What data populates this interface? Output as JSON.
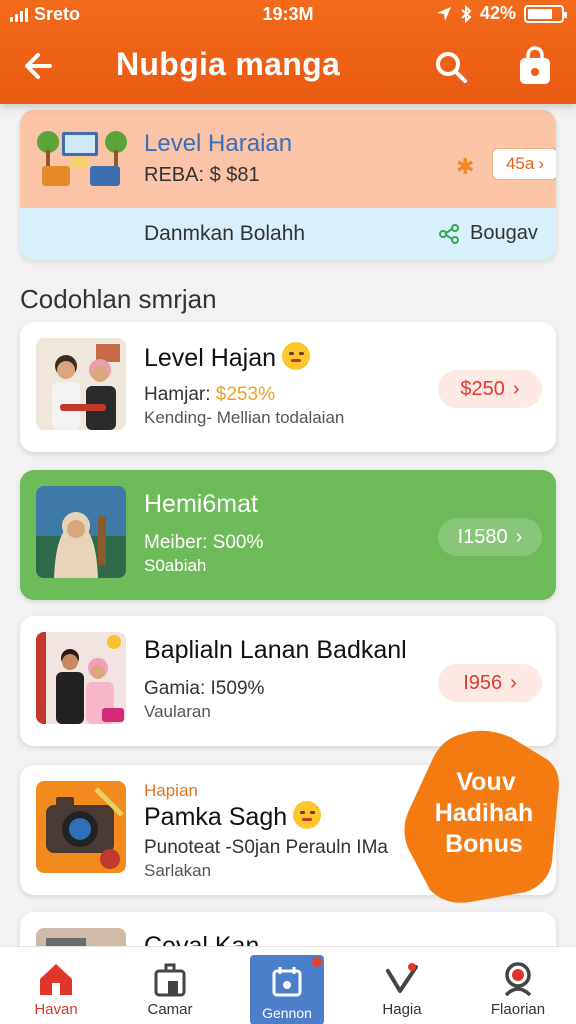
{
  "status_bar": {
    "carrier": "Sreto",
    "time": "19:3M",
    "battery": "42%"
  },
  "header": {
    "title": "Nubgia manga"
  },
  "top_card": {
    "title": "Level Haraian",
    "subtitle": "REBA: $ $81",
    "sparkle": "✱",
    "pill": "45a",
    "lower_text": "Danmkan Bolahh",
    "lower_action": "Bougav"
  },
  "section_title": "Codohlan smrjan",
  "items": [
    {
      "title": "Level Hajan",
      "line1_label": "Hamjar:",
      "line1_value": "$253%",
      "line2": "Kending- Mellian todalaian",
      "price": "$250"
    },
    {
      "title": "Hemi6mat",
      "line1_label": "Meiber:",
      "line1_value": "S00%",
      "line2": "S0abiah",
      "price": "I1580"
    },
    {
      "title": "Baplialn Lanan Badkanl",
      "line1_label": "Gamia:",
      "line1_value": "I509%",
      "line2": "Vaularan",
      "price": "I956"
    },
    {
      "tag": "Hapian",
      "title": "Pamka Sagh",
      "line1_label": "Punoteat -S0jan Perauln IMa",
      "line1_value": "",
      "line2": "Sarlakan"
    },
    {
      "title": "Ceval Kan"
    }
  ],
  "promo_badge": {
    "line1": "Vouv",
    "line2": "Hadihah",
    "line3": "Bonus"
  },
  "tabbar": [
    {
      "label": "Havan",
      "icon": "home-icon"
    },
    {
      "label": "Camar",
      "icon": "store-icon"
    },
    {
      "label": "Gennon",
      "icon": "calendar-icon"
    },
    {
      "label": "Hagia",
      "icon": "heart-check-icon"
    },
    {
      "label": "Flaorian",
      "icon": "search-person-icon"
    }
  ],
  "colors": {
    "accent": "#ea5a12",
    "green_card": "#6dbb59",
    "price_red": "#e23a2e",
    "tab_active_bg": "#4b7fc9"
  }
}
